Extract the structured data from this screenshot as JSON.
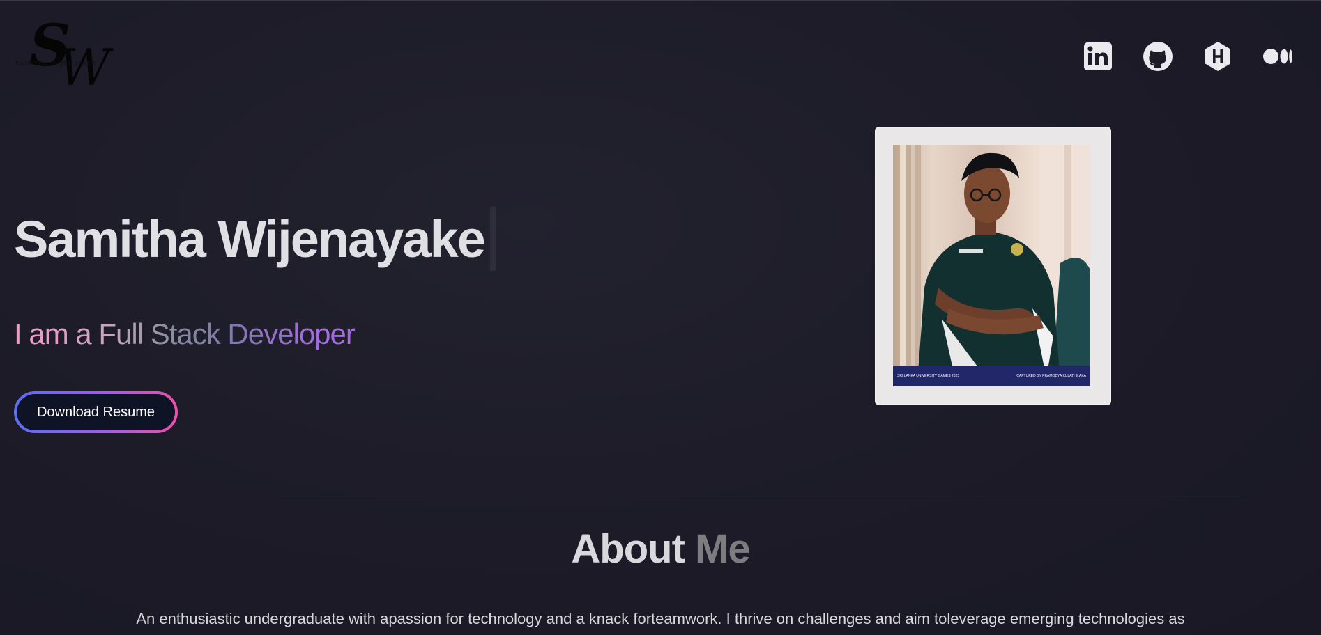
{
  "logo": {
    "monogram_s": "S",
    "monogram_w": "W",
    "small_text": "SAMITHA WIJENAYAKE"
  },
  "socials": [
    {
      "name": "LinkedIn",
      "icon": "linkedin-icon"
    },
    {
      "name": "GitHub",
      "icon": "github-icon"
    },
    {
      "name": "Hashnode",
      "icon": "hashnode-icon"
    },
    {
      "name": "Medium",
      "icon": "medium-icon"
    }
  ],
  "hero": {
    "name": "Samitha Wijenayake",
    "role": "I am a Full Stack Developer",
    "resume_button": "Download Resume"
  },
  "photo": {
    "caption_left": "SRI LANKA UNIVERSITY GAMES 2023",
    "caption_right": "CAPTURED BY PRAMODYA KULATHILAKA"
  },
  "about": {
    "title_word1": "About",
    "title_word2": "Me",
    "text": "An enthusiastic undergraduate with apassion for technology and a knack forteamwork. I thrive on challenges and aim toleverage emerging technologies as"
  },
  "colors": {
    "background": "#1c1b27",
    "name_text": "#e0e0e4",
    "button_bg": "#0e1326",
    "gradient_start": "#5b6ef5",
    "gradient_end": "#ee4fa8",
    "icon": "#e9e9ee"
  }
}
